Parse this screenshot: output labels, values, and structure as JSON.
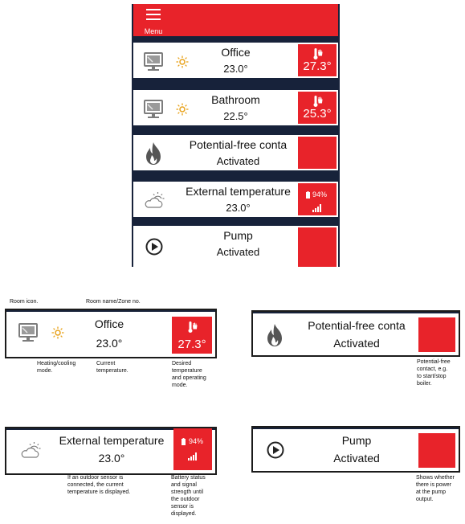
{
  "colors": {
    "accent": "#e8232a",
    "frame": "#17223a",
    "sun": "#e8a21a",
    "icon_gray": "#7c7c7c"
  },
  "app": {
    "menu_label": "Menu"
  },
  "rows": [
    {
      "icon": "monitor-icon",
      "mode_icon": "sun-icon",
      "title": "Office",
      "value": "23.0°",
      "side_icon": "thermometer-hand-icon",
      "side_value": "27.3°"
    },
    {
      "icon": "monitor-icon",
      "mode_icon": "sun-icon",
      "title": "Bathroom",
      "value": "22.5°",
      "side_icon": "thermometer-hand-icon",
      "side_value": "25.3°"
    },
    {
      "icon": "flame-icon",
      "title": "Potential-free conta",
      "value": "Activated"
    },
    {
      "icon": "cloud-sun-icon",
      "title": "External temperature",
      "value": "23.0°",
      "side_icon": "battery-icon",
      "battery": "94%",
      "signal_icon": "signal-bars-icon"
    },
    {
      "icon": "play-circle-icon",
      "title": "Pump",
      "value": "Activated"
    }
  ],
  "explanations": {
    "room_card": {
      "title": "Office",
      "value": "23.0°",
      "side_value": "27.3°",
      "label_room_icon": "Room icon.",
      "label_room_name": "Room name/Zone no.",
      "note_mode": "Heating/cooling\nmode.",
      "note_temp": "Current\ntemperature.",
      "note_desired": "Desired\ntemperature\nand operating\nmode."
    },
    "contact_card": {
      "title": "Potential-free conta",
      "value": "Activated",
      "note": "Potential-free\ncontact, e.g.\nto start/stop\nboiler."
    },
    "external_card": {
      "title": "External temperature",
      "value": "23.0°",
      "battery": "94%",
      "note_temp": "If an outdoor sensor is\nconnected, the current\ntemperature is displayed.",
      "note_battery": "Battery status\nand signal\nstrength until\nthe outdoor\nsensor is\ndisplayed."
    },
    "pump_card": {
      "title": "Pump",
      "value": "Activated",
      "note": "Shows whether\nthere is power\nat the pump\noutput."
    }
  }
}
